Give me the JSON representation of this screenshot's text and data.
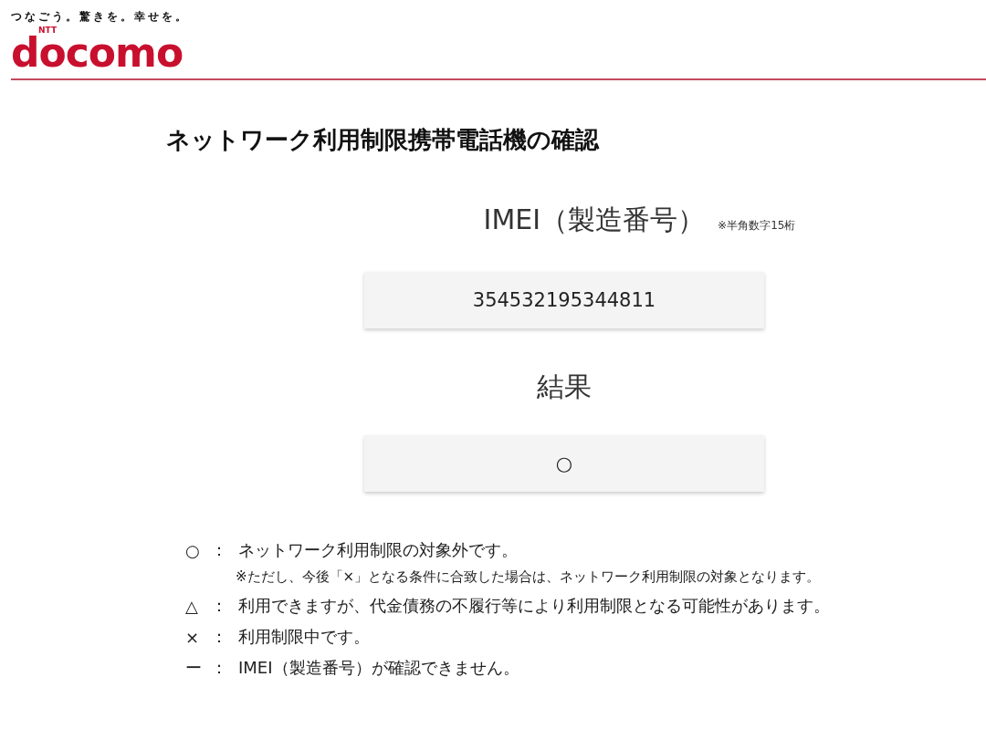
{
  "header": {
    "tagline": "つなごう。驚きを。幸せを。",
    "logo_small": "NTT",
    "logo": "docomo"
  },
  "title": "ネットワーク利用制限携帯電話機の確認",
  "imei": {
    "label": "IMEI（製造番号）",
    "hint": "※半角数字15桁",
    "value": "354532195344811"
  },
  "result": {
    "label": "結果",
    "value": "○"
  },
  "legend": [
    {
      "symbol": "○",
      "colon": "：",
      "text": "ネットワーク利用制限の対象外です。",
      "note": "※ただし、今後「×」となる条件に合致した場合は、ネットワーク利用制限の対象となります。"
    },
    {
      "symbol": "△",
      "colon": "：",
      "text": "利用できますが、代金債務の不履行等により利用制限となる可能性があります。"
    },
    {
      "symbol": "×",
      "colon": "：",
      "text": "利用制限中です。"
    },
    {
      "symbol": "ー",
      "colon": "：",
      "text": "IMEI（製造番号）が確認できません。"
    }
  ]
}
